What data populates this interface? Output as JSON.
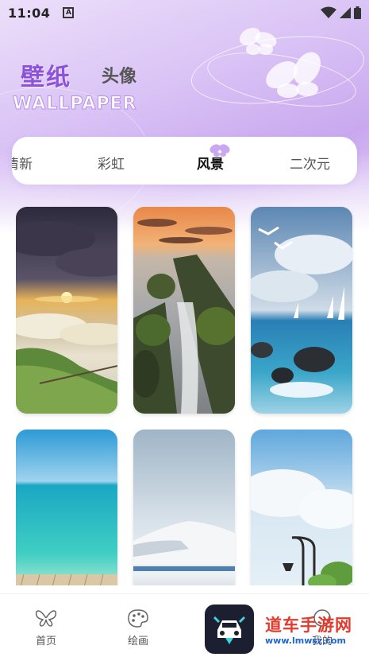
{
  "status": {
    "time": "11:04",
    "notification_glyph": "A"
  },
  "header": {
    "title": "壁纸",
    "subtitle": "头像",
    "english": "WALLPAPER"
  },
  "tabs": [
    {
      "label": "清新",
      "active": false
    },
    {
      "label": "彩虹",
      "active": false
    },
    {
      "label": "风景",
      "active": true
    },
    {
      "label": "二次元",
      "active": false
    }
  ],
  "wallpapers": [
    {
      "scene": "sunset-above-clouds"
    },
    {
      "scene": "coastal-rocks-sunset"
    },
    {
      "scene": "seagulls-sailboats"
    },
    {
      "scene": "turquoise-sea-pier"
    },
    {
      "scene": "snowy-mountain-lake"
    },
    {
      "scene": "sky-streetlamp"
    }
  ],
  "nav": {
    "items": [
      {
        "label": "首页",
        "icon": "butterfly-icon"
      },
      {
        "label": "绘画",
        "icon": "palette-icon"
      },
      {
        "label": "我的",
        "icon": "profile-icon"
      }
    ],
    "center_icon": "car-logo-icon"
  },
  "watermark": {
    "text": "道车手游网",
    "url": "www.lmwsz.com"
  },
  "colors": {
    "accent": "#8c52d9",
    "hero": "#d9c2f5"
  }
}
